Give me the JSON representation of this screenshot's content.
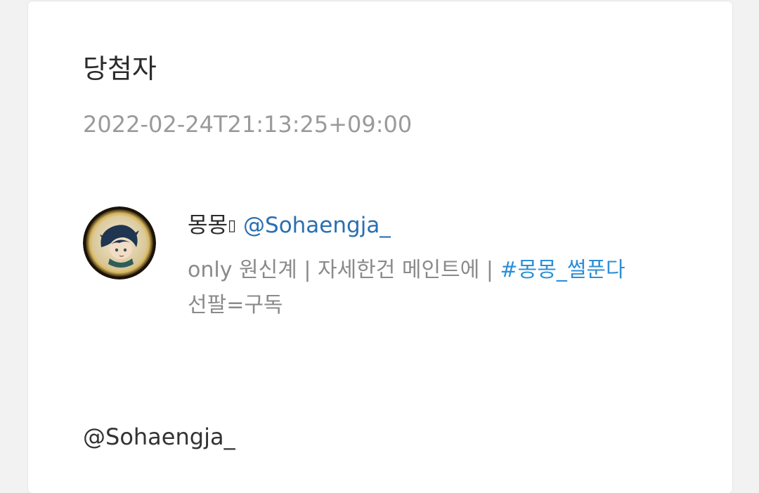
{
  "post": {
    "title": "당첨자",
    "timestamp": "2022-02-24T21:13:25+09:00"
  },
  "profile": {
    "display_name": "몽몽",
    "name_suffix_glyph": "▯",
    "handle": "@Sohaengja_",
    "avatar_icon": "character-avatar-icon",
    "bio_prefix": "only 원신계 | 자세한건 메인트에 | ",
    "bio_hashtag": "#몽몽_썰푼다",
    "bio_line2": "선팔=구독"
  },
  "footer": {
    "handle": "@Sohaengja_"
  },
  "colors": {
    "handle": "#2a6fb0",
    "hashtag": "#2e8fd6",
    "muted": "#9a9a9a",
    "text": "#2b2b2b"
  }
}
